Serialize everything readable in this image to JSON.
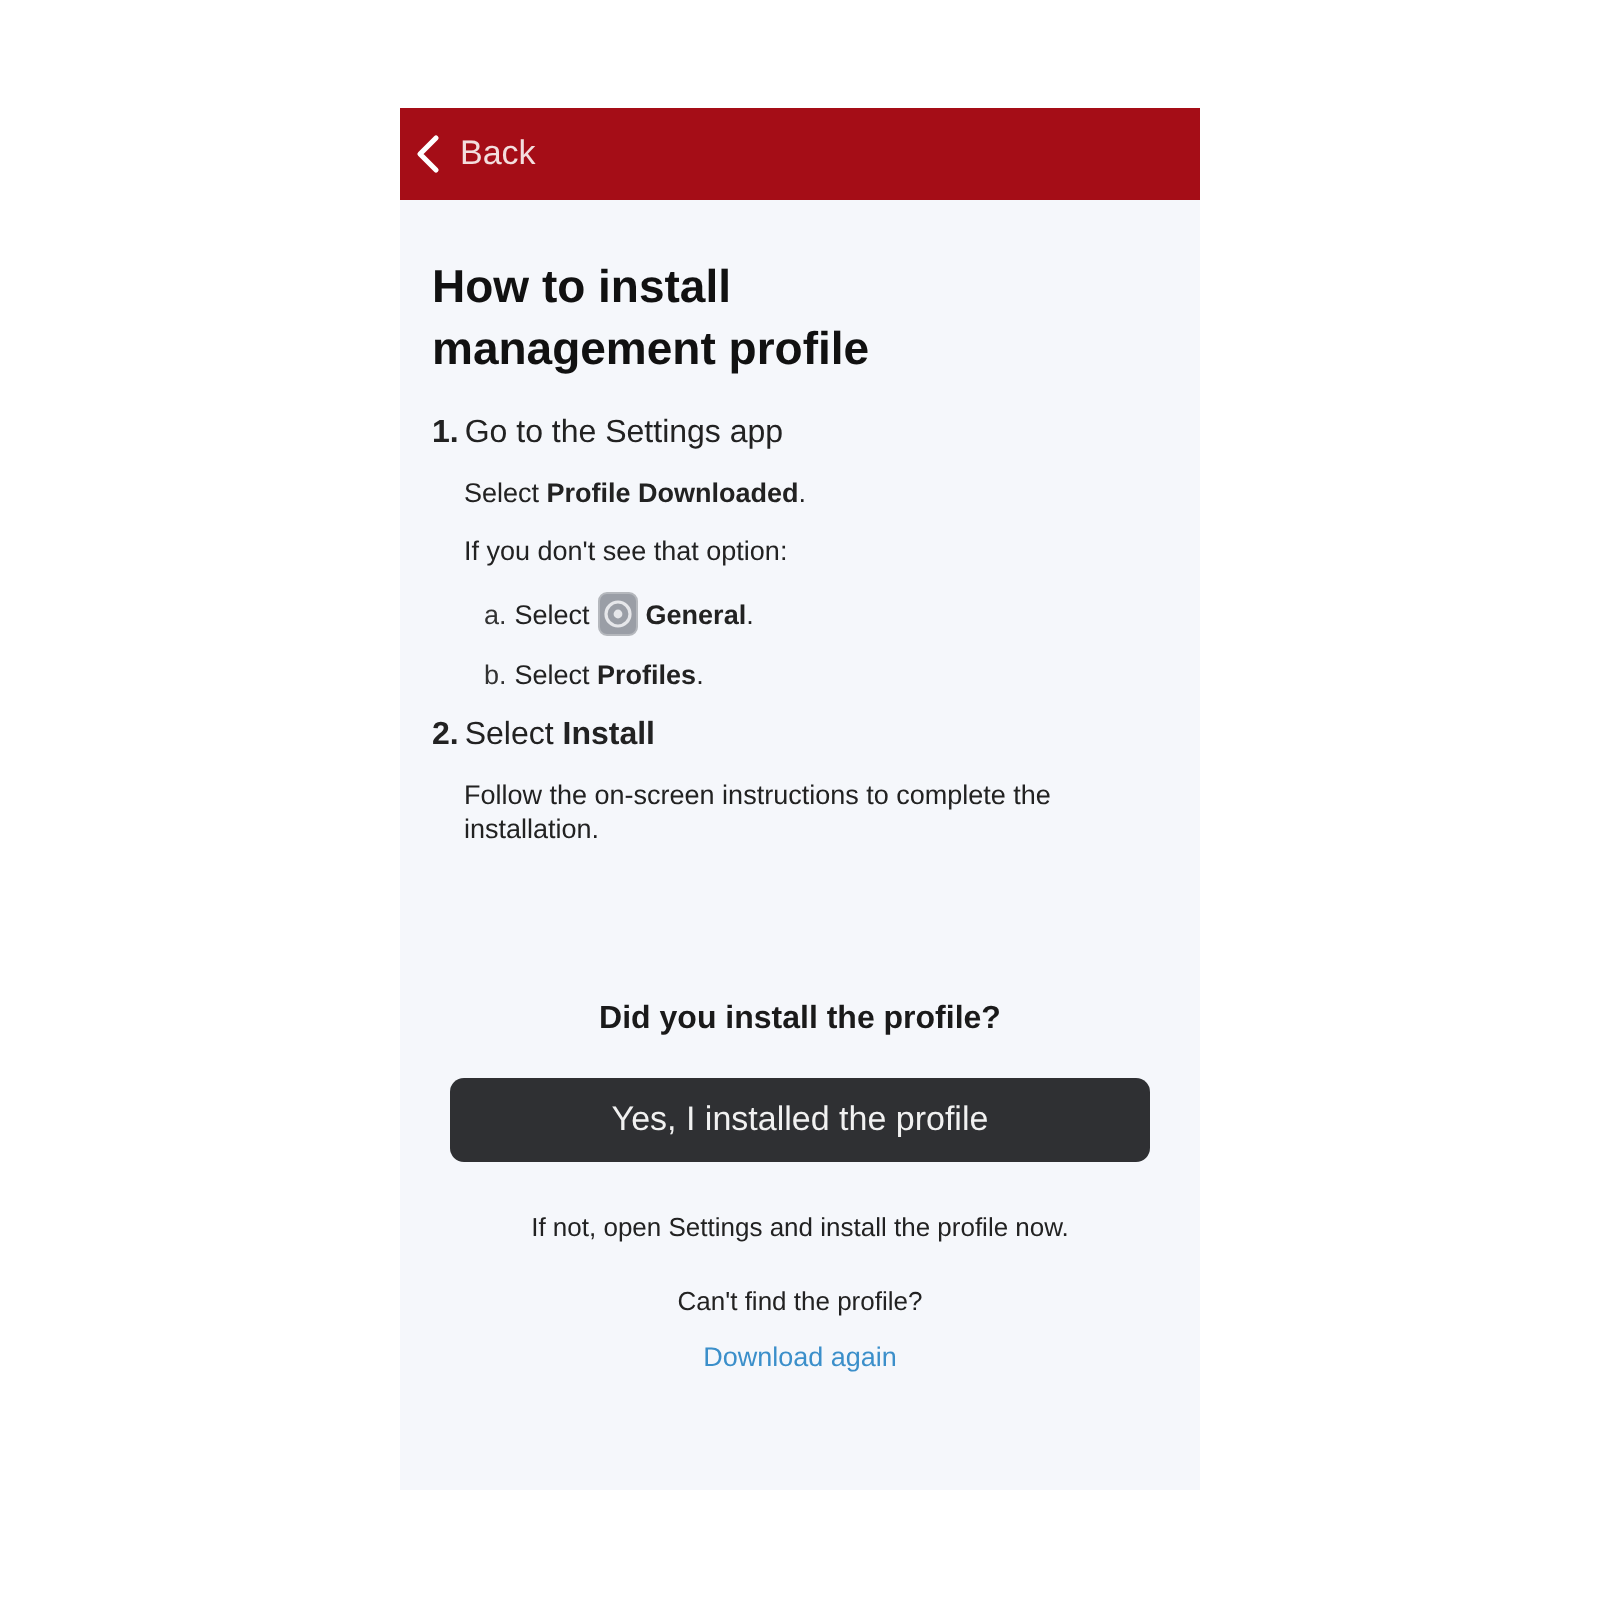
{
  "nav_bar": {
    "back_label": "Back"
  },
  "title": "How to install management profile",
  "steps": [
    {
      "number": "1.",
      "heading": "Go to the Settings app",
      "paragraphs": [
        "Select **Profile Downloaded**.",
        "If you don't see that option:"
      ],
      "substeps": [
        {
          "marker": "a.",
          "kind": "with_icon",
          "before": "Select",
          "after": "**General**."
        },
        {
          "marker": "b.",
          "kind": "plain",
          "text": "Select **Profiles**."
        }
      ]
    },
    {
      "number": "2.",
      "heading": "Select **Install**",
      "paragraphs": [
        "Follow the on-screen instructions to complete the installation."
      ]
    }
  ],
  "footer": {
    "question": "Did you install the profile?",
    "confirm_button": "Yes, I installed the profile",
    "hint": "If not, open Settings and install the profile now.",
    "help_question": "Can't find the profile?",
    "link": "Download again"
  }
}
